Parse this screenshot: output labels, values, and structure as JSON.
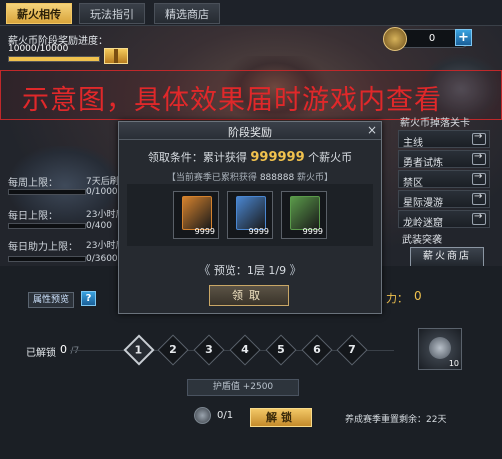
{
  "tabs": [
    {
      "label": "薪火相传",
      "active": true
    },
    {
      "label": "玩法指引",
      "active": false
    },
    {
      "label": "精选商店",
      "active": false
    }
  ],
  "progress": {
    "label": "薪火币阶段奖励进度：",
    "value": "10000/10000",
    "fill_fraction": 1.0
  },
  "currency": {
    "value": "0",
    "plus": "+"
  },
  "watermark": "示意图，具体效果届时游戏内查看",
  "limits": [
    {
      "label": "每周上限：",
      "side": "7天后刷",
      "value": "0/10000",
      "fill_fraction": 0
    },
    {
      "label": "每日上限：",
      "side": "23小时后",
      "value": "0/400",
      "fill_fraction": 0
    },
    {
      "label": "每日助力上限：",
      "side": "23小时后",
      "value": "0/3600",
      "fill_fraction": 0
    }
  ],
  "side_menu": {
    "title": "薪火币掉落关卡",
    "items": [
      "主线",
      "勇者试炼",
      "禁区",
      "星际漫游",
      "龙岭迷窟",
      "武装突袭"
    ],
    "shop_label": "薪火商店"
  },
  "modal": {
    "title": "阶段奖励",
    "close": "×",
    "condition_prefix": "领取条件：累计获得",
    "condition_amount": "999999",
    "condition_suffix": "个薪火币",
    "hint_prefix": "【当前赛季已累积获得",
    "hint_amount": "888888",
    "hint_suffix": "薪火币】",
    "rewards": [
      {
        "count": "9999",
        "color": "#d4822e"
      },
      {
        "count": "9999",
        "color": "#4a86d0"
      },
      {
        "count": "9999",
        "color": "#5a9a4a"
      }
    ],
    "pager_left": "《",
    "pager_text": "预览：1层",
    "pager_page": "1/9",
    "pager_right": "》",
    "claim_label": "领取"
  },
  "lower": {
    "attr_preview": "属性预览",
    "help": "?",
    "power_label": "力：",
    "power_value": "0",
    "unlocked_label": "已解锁",
    "unlocked_value": "0",
    "unlocked_max": "/7",
    "nodes": [
      "1",
      "2",
      "3",
      "4",
      "5",
      "6",
      "7"
    ],
    "boss_count": "10",
    "shield_text": "护盾值 +2500",
    "material_value": "0/1",
    "unlock_label": "解锁",
    "reset_text": "养成赛季重置剩余：22天"
  }
}
